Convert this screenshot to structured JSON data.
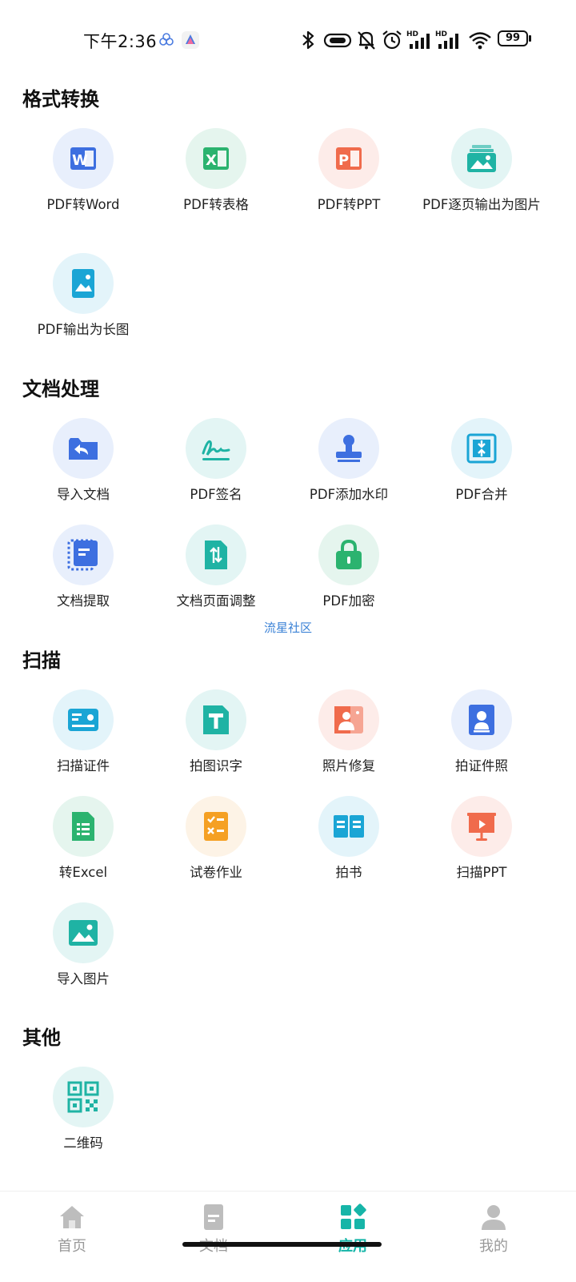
{
  "status_bar": {
    "time": "下午2:36",
    "battery": "99",
    "icons": [
      "bluetooth-icon",
      "vibrate-icon",
      "mute-bell-icon",
      "alarm-icon",
      "signal-hd-icon",
      "signal-hd-icon",
      "wifi-icon",
      "battery-icon"
    ]
  },
  "sections": [
    {
      "title": "格式转换",
      "items": [
        {
          "label": "PDF转Word",
          "icon": "word-icon",
          "bg": "#e8effc",
          "color": "#3d6fe0"
        },
        {
          "label": "PDF转表格",
          "icon": "excel-icon",
          "bg": "#e5f5ee",
          "color": "#2bb36f"
        },
        {
          "label": "PDF转PPT",
          "icon": "ppt-icon",
          "bg": "#fdece9",
          "color": "#f06b4c"
        },
        {
          "label": "PDF逐页输出为图片",
          "icon": "image-stack-icon",
          "bg": "#e3f5f4",
          "color": "#1fb3a4"
        },
        {
          "label": "PDF输出为长图",
          "icon": "long-image-icon",
          "bg": "#e3f4fa",
          "color": "#1aa5d5"
        }
      ]
    },
    {
      "title": "文档处理",
      "items": [
        {
          "label": "导入文档",
          "icon": "folder-import-icon",
          "bg": "#e8effc",
          "color": "#3d6fe0"
        },
        {
          "label": "PDF签名",
          "icon": "signature-icon",
          "bg": "#e3f5f4",
          "color": "#1fb3a4"
        },
        {
          "label": "PDF添加水印",
          "icon": "stamp-icon",
          "bg": "#e8effc",
          "color": "#3d6fe0"
        },
        {
          "label": "PDF合并",
          "icon": "merge-icon",
          "bg": "#e3f4fa",
          "color": "#1aa5d5"
        },
        {
          "label": "文档提取",
          "icon": "extract-icon",
          "bg": "#e8effc",
          "color": "#3d6fe0"
        },
        {
          "label": "文档页面调整",
          "icon": "page-adjust-icon",
          "bg": "#e3f5f4",
          "color": "#1fb3a4"
        },
        {
          "label": "PDF加密",
          "icon": "lock-icon",
          "bg": "#e5f5ee",
          "color": "#2bb36f"
        }
      ]
    },
    {
      "title": "扫描",
      "items": [
        {
          "label": "扫描证件",
          "icon": "id-card-icon",
          "bg": "#e3f4fa",
          "color": "#1aa5d5"
        },
        {
          "label": "拍图识字",
          "icon": "text-recognition-icon",
          "bg": "#e3f5f4",
          "color": "#1fb3a4"
        },
        {
          "label": "照片修复",
          "icon": "photo-repair-icon",
          "bg": "#fdece9",
          "color": "#f06b4c"
        },
        {
          "label": "拍证件照",
          "icon": "id-photo-icon",
          "bg": "#e8effc",
          "color": "#3d6fe0"
        },
        {
          "label": "转Excel",
          "icon": "sheet-icon",
          "bg": "#e5f5ee",
          "color": "#2bb36f"
        },
        {
          "label": "试卷作业",
          "icon": "exam-icon",
          "bg": "#fdf3e6",
          "color": "#f5a023"
        },
        {
          "label": "拍书",
          "icon": "book-icon",
          "bg": "#e3f4fa",
          "color": "#1aa5d5"
        },
        {
          "label": "扫描PPT",
          "icon": "presentation-icon",
          "bg": "#fdece9",
          "color": "#f06b4c"
        },
        {
          "label": "导入图片",
          "icon": "image-import-icon",
          "bg": "#e3f5f4",
          "color": "#1fb3a4"
        }
      ]
    },
    {
      "title": "其他",
      "items": [
        {
          "label": "二维码",
          "icon": "qr-code-icon",
          "bg": "#e3f5f4",
          "color": "#1fb3a4"
        }
      ]
    }
  ],
  "watermark": "流星社区",
  "nav": [
    {
      "label": "首页",
      "icon": "home-icon"
    },
    {
      "label": "文档",
      "icon": "document-icon"
    },
    {
      "label": "应用",
      "icon": "apps-icon",
      "active": true
    },
    {
      "label": "我的",
      "icon": "profile-icon"
    }
  ],
  "colors": {
    "accent": "#16b5a8",
    "inactive": "#bdbdbd"
  }
}
